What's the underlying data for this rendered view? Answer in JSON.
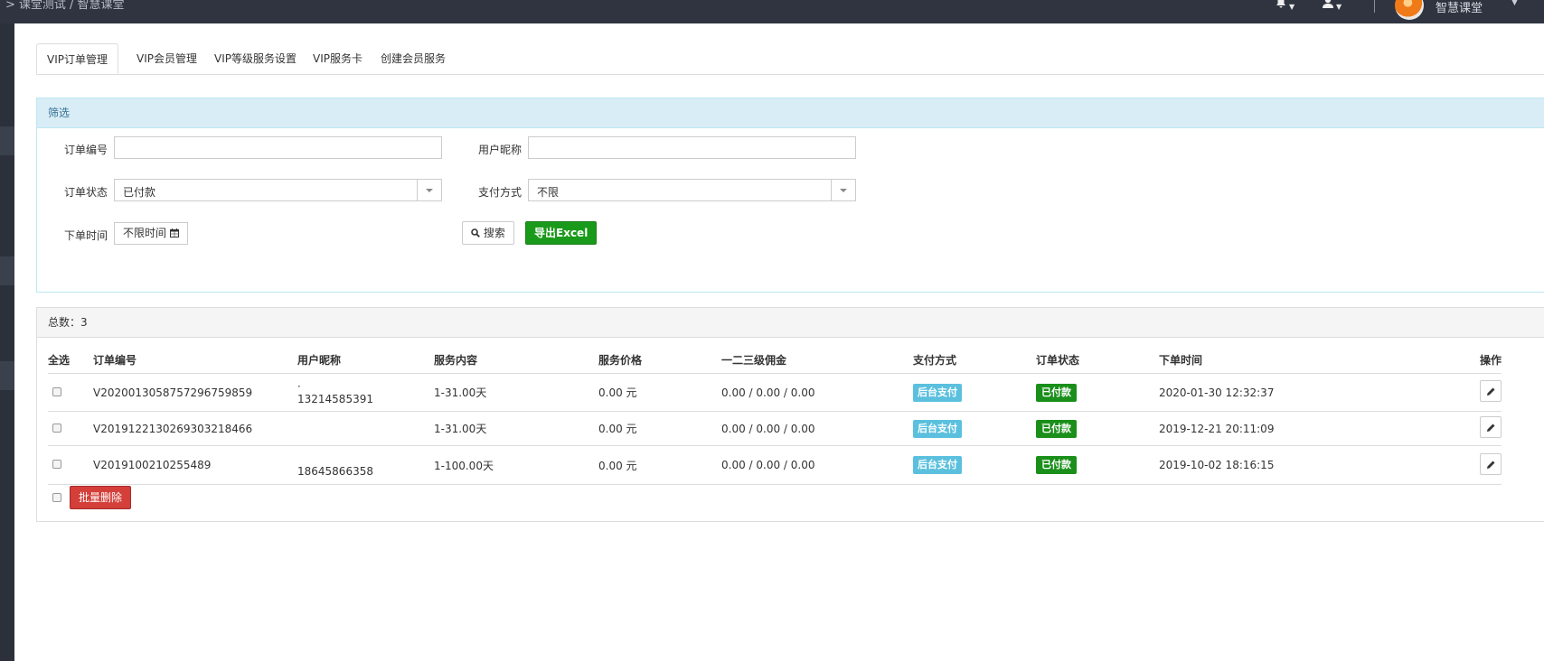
{
  "topbar": {
    "breadcrumb_prefix": ">",
    "breadcrumb": "课堂测试 / 智慧课堂",
    "username": "智慧课堂"
  },
  "tabs": [
    {
      "label": "VIP订单管理",
      "active": true
    },
    {
      "label": "VIP会员管理",
      "active": false
    },
    {
      "label": "VIP等级服务设置",
      "active": false
    },
    {
      "label": "VIP服务卡",
      "active": false
    },
    {
      "label": "创建会员服务",
      "active": false
    }
  ],
  "filter": {
    "title": "筛选",
    "order_no_label": "订单编号",
    "order_no_value": "",
    "nickname_label": "用户昵称",
    "nickname_value": "",
    "status_label": "订单状态",
    "status_value": "已付款",
    "pay_label": "支付方式",
    "pay_value": "不限",
    "time_label": "下单时间",
    "time_value": "不限时间",
    "search_button": "搜索",
    "export_button": "导出Excel"
  },
  "list": {
    "total_text": "总数：3",
    "columns": [
      "全选",
      "订单编号",
      "用户昵称",
      "服务内容",
      "服务价格",
      "一二三级佣金",
      "支付方式",
      "订单状态",
      "下单时间",
      "操作"
    ],
    "rows": [
      {
        "order_no": "V2020013058757296759859",
        "nick_top": "·",
        "nick_bottom": "13214585391",
        "service": "1-31.00天",
        "price": "0.00 元",
        "commission": "0.00 / 0.00 / 0.00",
        "pay": "后台支付",
        "status": "已付款",
        "time": "2020-01-30 12:32:37"
      },
      {
        "order_no": "V2019122130269303218466",
        "nick_top": "",
        "nick_bottom": "",
        "service": "1-31.00天",
        "price": "0.00 元",
        "commission": "0.00 / 0.00 / 0.00",
        "pay": "后台支付",
        "status": "已付款",
        "time": "2019-12-21 20:11:09"
      },
      {
        "order_no": "V2019100210255489",
        "nick_top": "",
        "nick_bottom": "18645866358",
        "service": "1-100.00天",
        "price": "0.00 元",
        "commission": "0.00 / 0.00 / 0.00",
        "pay": "后台支付",
        "status": "已付款",
        "time": "2019-10-02 18:16:15"
      }
    ],
    "batch_delete": "批量删除"
  },
  "icons": {
    "bell": "bell-icon",
    "user": "user-icon",
    "search": "search-icon",
    "calendar": "calendar-icon",
    "edit": "pencil-icon"
  }
}
